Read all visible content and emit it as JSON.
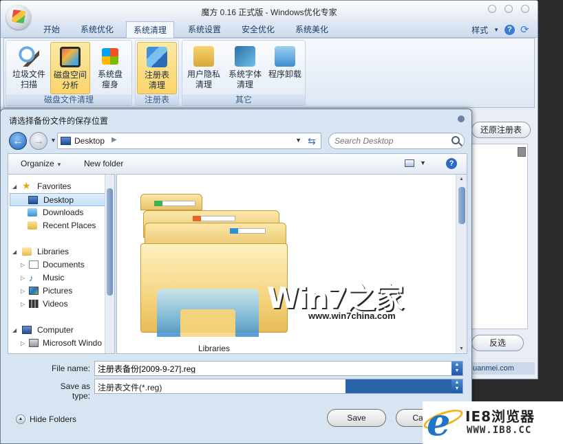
{
  "app": {
    "title": "魔方 0.16 正式版 - Windows优化专家",
    "tabs": [
      "开始",
      "系统优化",
      "系统清理",
      "系统设置",
      "安全优化",
      "系统美化"
    ],
    "active_tab": "系统清理",
    "style_label": "样式",
    "groups": [
      {
        "label": "磁盘文件清理",
        "buttons": [
          {
            "line1": "垃圾文件",
            "line2": "扫描",
            "icon": "magnifier-icon"
          },
          {
            "line1": "磁盘空间",
            "line2": "分析",
            "icon": "disk-chart-icon"
          },
          {
            "line1": "系统盘",
            "line2": "瘦身",
            "icon": "windows-logo-icon"
          }
        ]
      },
      {
        "label": "注册表",
        "buttons": [
          {
            "line1": "注册表",
            "line2": "清理",
            "icon": "registry-blocks-icon"
          }
        ]
      },
      {
        "label": "其它",
        "buttons": [
          {
            "line1": "用户隐私",
            "line2": "清理",
            "icon": "lock-icon"
          },
          {
            "line1": "系统字体",
            "line2": "清理",
            "icon": "font-icon"
          },
          {
            "line1": "程序卸载",
            "line2": "",
            "icon": "recycle-bin-icon"
          }
        ]
      }
    ],
    "side": {
      "restore_label": "还原注册表",
      "invert_label": "反选",
      "footer_text": "uanmei.com"
    }
  },
  "dialog": {
    "title": "请选择备份文件的保存位置",
    "address": "Desktop",
    "search_placeholder": "Search Desktop",
    "toolbar": {
      "organize": "Organize",
      "new_folder": "New folder"
    },
    "nav": {
      "favorites": {
        "label": "Favorites",
        "items": [
          "Desktop",
          "Downloads",
          "Recent Places"
        ]
      },
      "libraries": {
        "label": "Libraries",
        "items": [
          "Documents",
          "Music",
          "Pictures",
          "Videos"
        ]
      },
      "computer": {
        "label": "Computer",
        "items": [
          "Microsoft Windo"
        ]
      }
    },
    "main_item_label": "Libraries",
    "file_name_label": "File name:",
    "file_name_value": "注册表备份[2009-9-27].reg",
    "save_type_label": "Save as type:",
    "save_type_value": "注册表文件(*.reg)",
    "hide_folders": "Hide Folders",
    "save_button": "Save",
    "cancel_button": "Cancel"
  },
  "watermarks": {
    "win7_text": "Win7之家",
    "win7_url": "www.win7china.com",
    "ie8_title": "IE8浏览器",
    "ie8_url": "WWW.IB8.CC"
  }
}
